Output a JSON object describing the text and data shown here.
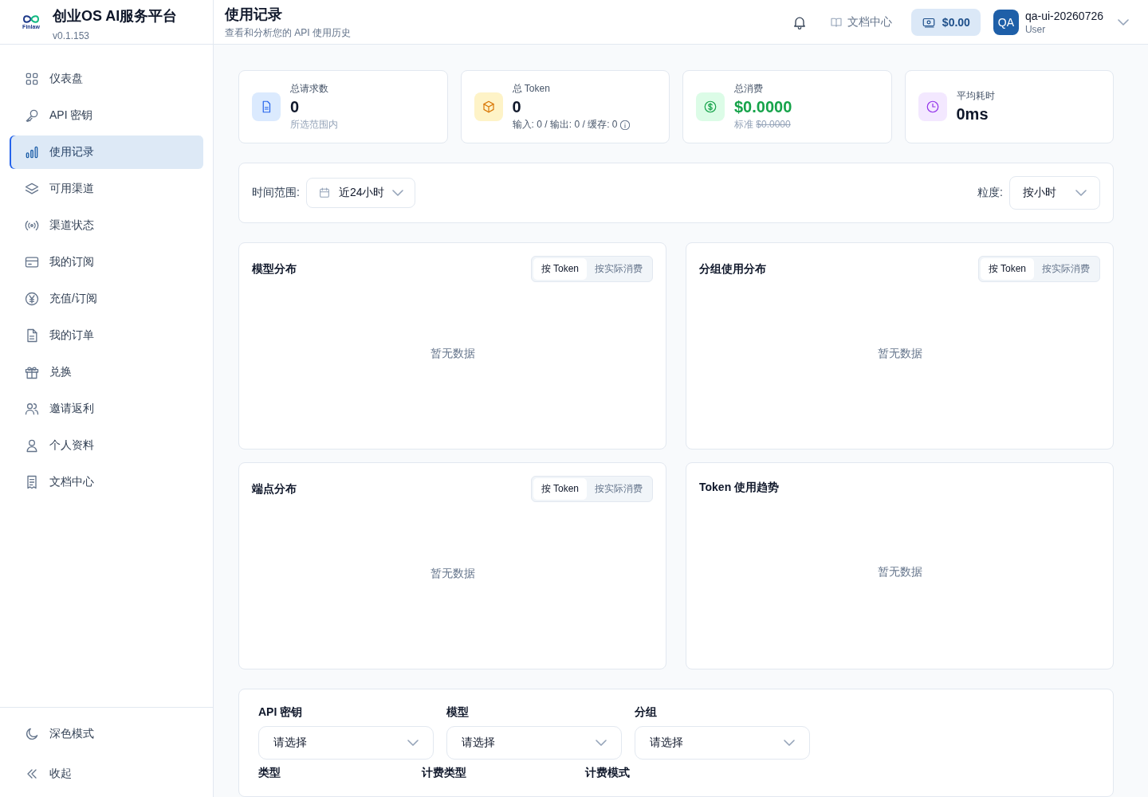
{
  "brand": {
    "logo_text": "Finlaw",
    "title": "创业OS AI服务平台",
    "version": "v0.1.153"
  },
  "nav": [
    {
      "label": "仪表盘",
      "selected": false
    },
    {
      "label": "API 密钥",
      "selected": false
    },
    {
      "label": "使用记录",
      "selected": true
    },
    {
      "label": "可用渠道",
      "selected": false
    },
    {
      "label": "渠道状态",
      "selected": false
    },
    {
      "label": "我的订阅",
      "selected": false
    },
    {
      "label": "充值/订阅",
      "selected": false
    },
    {
      "label": "我的订单",
      "selected": false
    },
    {
      "label": "兑换",
      "selected": false
    },
    {
      "label": "邀请返利",
      "selected": false
    },
    {
      "label": "个人资料",
      "selected": false
    },
    {
      "label": "文档中心",
      "selected": false
    }
  ],
  "sidebar_footer": [
    {
      "kind": "theme",
      "label": "深色模式"
    },
    {
      "kind": "collapse",
      "label": "收起"
    }
  ],
  "header": {
    "title": "使用记录",
    "subtitle": "查看和分析您的 API 使用历史",
    "docs_link": "文档中心",
    "balance": "$0.00",
    "avatar": "QA",
    "username": "qa-ui-20260726",
    "role": "User"
  },
  "stats": [
    {
      "kind": "requests",
      "color": "#dbeafe",
      "label": "总请求数",
      "value": "0",
      "sub": "所选范围内"
    },
    {
      "kind": "tokens",
      "color": "#fef3c7",
      "label": "总 Token",
      "value": "0",
      "sub": "输入: 0 / 输出: 0 / 缓存: 0",
      "info": true
    },
    {
      "kind": "cost",
      "color": "#dcfce7",
      "label": "总消费",
      "value": "$0.0000",
      "sub": "标准",
      "struck": "$0.0000"
    },
    {
      "kind": "latency",
      "color": "#f3e8ff",
      "label": "平均耗时",
      "value": "0ms"
    }
  ],
  "range_bar": {
    "range_label": "时间范围:",
    "range_value": "近24小时",
    "granularity_label": "粒度:",
    "granularity_value": "按小时"
  },
  "panels": [
    {
      "title": "模型分布",
      "toggle": [
        {
          "label": "按 Token",
          "selected": true
        },
        {
          "label": "按实际消费",
          "selected": false
        }
      ],
      "empty": "暂无数据"
    },
    {
      "title": "分组使用分布",
      "toggle": [
        {
          "label": "按 Token",
          "selected": true
        },
        {
          "label": "按实际消费",
          "selected": false
        }
      ],
      "empty": "暂无数据"
    },
    {
      "title": "端点分布",
      "toggle": [
        {
          "label": "按 Token",
          "selected": true
        },
        {
          "label": "按实际消费",
          "selected": false
        }
      ],
      "empty": "暂无数据"
    },
    {
      "title": "Token 使用趋势",
      "empty": "暂无数据"
    }
  ],
  "filters": [
    {
      "label": "API 密钥",
      "placeholder": "请选择"
    },
    {
      "label": "模型",
      "placeholder": "请选择"
    },
    {
      "label": "分组",
      "placeholder": "请选择"
    }
  ],
  "filters_row2": [
    "类型",
    "计费类型",
    "计费模式"
  ]
}
